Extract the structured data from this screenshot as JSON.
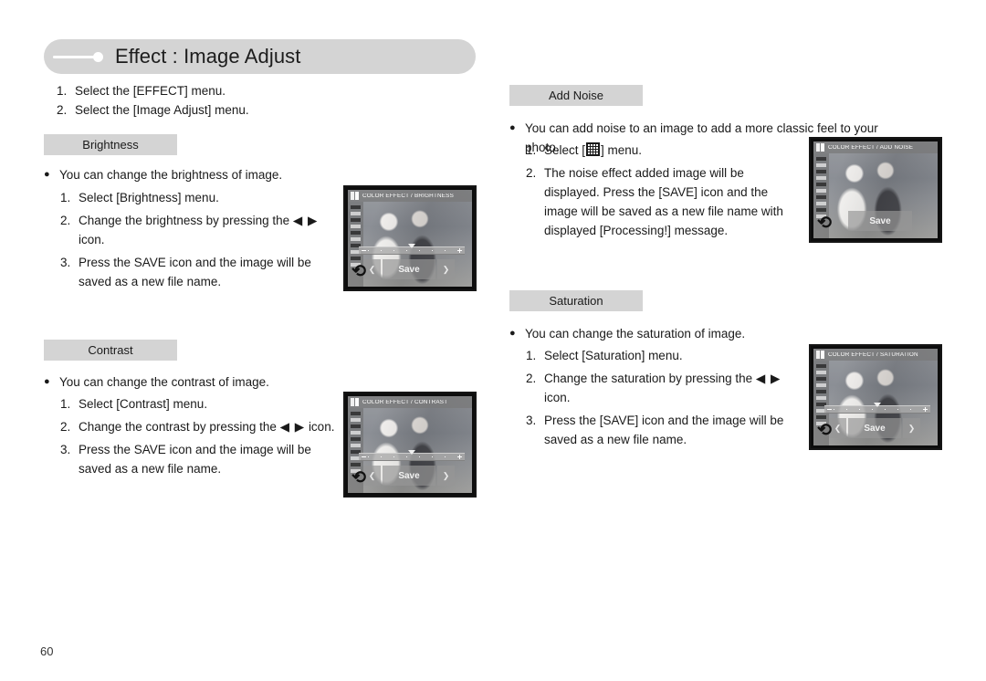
{
  "header": {
    "title": "Effect : Image Adjust",
    "deco_icon": "line-dot-decoration"
  },
  "intro": {
    "steps": [
      {
        "num": "1.",
        "text": "Select the [EFFECT] menu."
      },
      {
        "num": "2.",
        "text": "Select the [Image Adjust] menu."
      }
    ]
  },
  "sections": {
    "brightness": {
      "heading": "Brightness",
      "bullet": "You can change the brightness of image.",
      "steps": [
        {
          "num": "1.",
          "text": "Select [Brightness] menu."
        },
        {
          "num": "2.",
          "text_before": "Change the brightness by pressing the",
          "arrows": "◀ ▶",
          "text_after": "icon."
        },
        {
          "num": "3.",
          "text": "Press the SAVE icon and the image will be saved as a new file name."
        }
      ],
      "lcd": {
        "title": "COLOR EFFECT / BRIGHTNESS",
        "save_label": "Save",
        "left_arrow": "❮",
        "right_arrow": "❯",
        "back_icon": "back-arrow-icon",
        "has_slider": true
      }
    },
    "contrast": {
      "heading": "Contrast",
      "bullet": "You can change the contrast of image.",
      "steps": [
        {
          "num": "1.",
          "text": "Select [Contrast] menu."
        },
        {
          "num": "2.",
          "text_before": "Change the contrast by pressing the",
          "arrows": "◀ ▶",
          "text_after": "icon."
        },
        {
          "num": "3.",
          "text": "Press the SAVE icon and the image will be saved as a new file name."
        }
      ],
      "lcd": {
        "title": "COLOR EFFECT / CONTRAST",
        "save_label": "Save",
        "left_arrow": "❮",
        "right_arrow": "❯",
        "back_icon": "back-arrow-icon",
        "has_slider": true
      }
    },
    "add_noise": {
      "heading": "Add Noise",
      "bullet": "You can add noise to an image to add a more classic feel to your photo.",
      "steps": [
        {
          "num": "1.",
          "text_before": "Select [",
          "icon": "noise-grid-icon",
          "text_after": "] menu."
        },
        {
          "num": "2.",
          "text": "The noise effect added image will be displayed. Press the [SAVE] icon and the image will be saved as a new file name with displayed [Processing!] message."
        }
      ],
      "lcd": {
        "title": "COLOR EFFECT / ADD NOISE",
        "save_label": "Save",
        "back_icon": "back-arrow-icon",
        "has_slider": false
      }
    },
    "saturation": {
      "heading": "Saturation",
      "bullet": "You can change the saturation of image.",
      "steps": [
        {
          "num": "1.",
          "text": "Select [Saturation] menu."
        },
        {
          "num": "2.",
          "text_before": "Change the saturation by pressing the",
          "arrows": "◀ ▶",
          "text_after": "icon."
        },
        {
          "num": "3.",
          "text": "Press the [SAVE] icon and the image will be saved as a new file name."
        }
      ],
      "lcd": {
        "title": "COLOR EFFECT / SATURATION",
        "save_label": "Save",
        "left_arrow": "❮",
        "right_arrow": "❯",
        "back_icon": "back-arrow-icon",
        "has_slider": true
      }
    }
  },
  "footer": {
    "page_number": "60"
  },
  "colors": {
    "header_pill": "#d4d4d4",
    "section_bar": "#d4d4d4",
    "text": "#1a1a1a",
    "page_background": "#ffffff"
  }
}
